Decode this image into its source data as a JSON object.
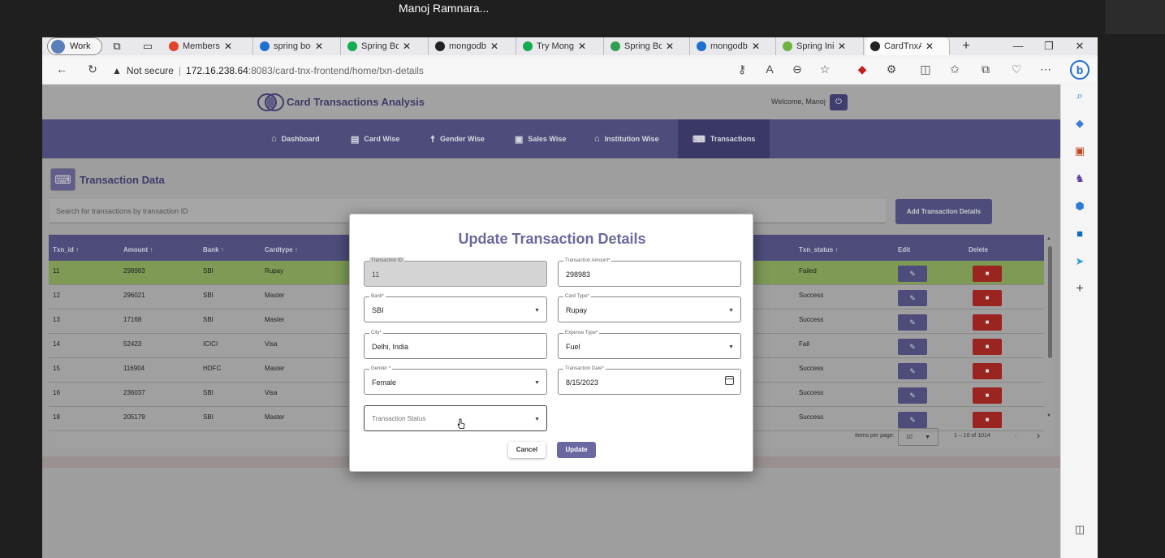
{
  "meeting": {
    "name": "Manoj Ramnara..."
  },
  "browser": {
    "profile": "Work",
    "tabs": [
      {
        "label": "Members · C",
        "icon": "gitlab-icon",
        "color": "#e24329"
      },
      {
        "label": "spring boot",
        "icon": "search-icon",
        "color": "#1f6fd0"
      },
      {
        "label": "Spring Boot",
        "icon": "mongodb-leaf-icon",
        "color": "#13aa52"
      },
      {
        "label": "mongodb-s",
        "icon": "github-icon",
        "color": "#222222"
      },
      {
        "label": "Try Mongo",
        "icon": "mongodb-leaf-icon",
        "color": "#13aa52"
      },
      {
        "label": "Spring Boot",
        "icon": "link-icon",
        "color": "#2f9f4f"
      },
      {
        "label": "mongodb c",
        "icon": "search-icon",
        "color": "#1f6fd0"
      },
      {
        "label": "Spring Initia",
        "icon": "spring-icon",
        "color": "#6db33f"
      },
      {
        "label": "CardTnxAna",
        "icon": "angular-icon",
        "color": "#222222"
      }
    ],
    "security_label": "Not secure",
    "url_host": "172.16.238.64",
    "url_path": ":8083/card-tnx-frontend/home/txn-details"
  },
  "app": {
    "title": "Card Transactions Analysis",
    "welcome": "Welcome, Manoj",
    "nav": [
      {
        "label": "Dashboard",
        "icon": "home-icon"
      },
      {
        "label": "Card Wise",
        "icon": "id-card-icon"
      },
      {
        "label": "Gender Wise",
        "icon": "person-icon"
      },
      {
        "label": "Sales Wise",
        "icon": "money-icon"
      },
      {
        "label": "Institution Wise",
        "icon": "bank-icon"
      },
      {
        "label": "Transactions",
        "icon": "keyboard-icon"
      }
    ],
    "section_title": "Transaction Data",
    "search_placeholder": "Search for transactions by transaction ID",
    "add_button": "Add Transaction Details",
    "columns": [
      "Txn_id",
      "Amount",
      "Bank",
      "Cardtype",
      "Txn_status",
      "Edit",
      "Delete"
    ],
    "rows": [
      {
        "id": "11",
        "amount": "298983",
        "bank": "SBI",
        "card": "Rupay",
        "status": "Failed"
      },
      {
        "id": "12",
        "amount": "296021",
        "bank": "SBI",
        "card": "Master",
        "status": "Success"
      },
      {
        "id": "13",
        "amount": "17168",
        "bank": "SBI",
        "card": "Master",
        "status": "Success"
      },
      {
        "id": "14",
        "amount": "52423",
        "bank": "ICICI",
        "card": "Visa",
        "status": "Fail"
      },
      {
        "id": "15",
        "amount": "116904",
        "bank": "HDFC",
        "card": "Master",
        "status": "Success"
      },
      {
        "id": "16",
        "amount": "236037",
        "bank": "SBI",
        "card": "Visa",
        "status": "Success"
      },
      {
        "id": "18",
        "amount": "205179",
        "bank": "SBI",
        "card": "Master",
        "status": "Success"
      }
    ],
    "paginator": {
      "label": "Items per page:",
      "size": "10",
      "range": "1 – 10 of 1014"
    }
  },
  "dialog": {
    "title": "Update Transaction Details",
    "fields": {
      "txn_id": {
        "label": "Transaction ID",
        "value": "11"
      },
      "amount": {
        "label": "Transaction Amount*",
        "value": "298983"
      },
      "bank": {
        "label": "Bank*",
        "value": "SBI"
      },
      "card_type": {
        "label": "Card Type*",
        "value": "Rupay"
      },
      "city": {
        "label": "City*",
        "value": "Delhi, India"
      },
      "expense": {
        "label": "Expense Type*",
        "value": "Fuel"
      },
      "gender": {
        "label": "Gender *",
        "value": "Female"
      },
      "date": {
        "label": "Transaction Date*",
        "value": "8/15/2023"
      },
      "status": {
        "placeholder": "Transaction Status"
      }
    },
    "cancel": "Cancel",
    "update": "Update"
  }
}
